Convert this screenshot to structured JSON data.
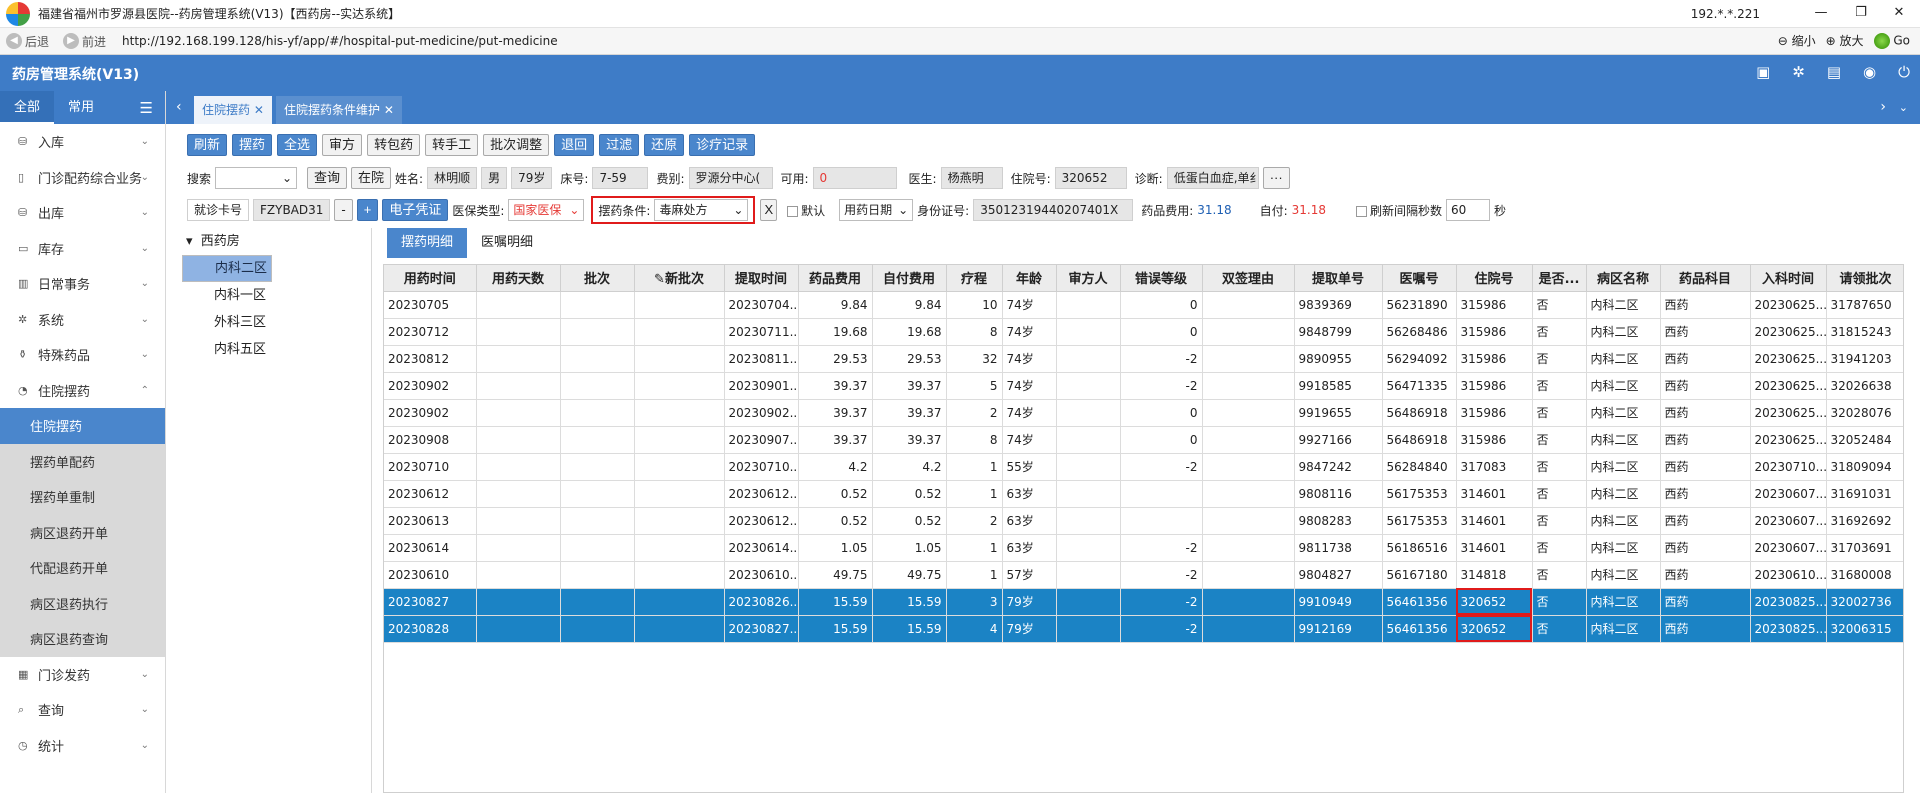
{
  "window": {
    "title": "福建省福州市罗源县医院--药房管理系统(V13)【西药房--实达系统】",
    "ip": "192.*.*.221",
    "minimize": "—",
    "restore": "❐",
    "close": "✕"
  },
  "browser": {
    "back": "后退",
    "forward": "前进",
    "url": "http://192.168.199.128/his-yf/app/#/hospital-put-medicine/put-medicine",
    "zoom_out": "缩小",
    "zoom_in": "放大",
    "go": "Go"
  },
  "app": {
    "title": "药房管理系统(V13)"
  },
  "sidebar": {
    "tabs": [
      "全部",
      "常用"
    ],
    "items": [
      {
        "label": "入库"
      },
      {
        "label": "门诊配药综合业务"
      },
      {
        "label": "出库"
      },
      {
        "label": "库存"
      },
      {
        "label": "日常事务"
      },
      {
        "label": "系统"
      },
      {
        "label": "特殊药品"
      },
      {
        "label": "住院摆药"
      }
    ],
    "subitems": [
      "住院摆药",
      "摆药单配药",
      "摆药单重制",
      "病区退药开单",
      "代配退药开单",
      "病区退药执行",
      "病区退药查询"
    ],
    "items_after": [
      {
        "label": "门诊发药"
      },
      {
        "label": "查询"
      },
      {
        "label": "统计"
      }
    ]
  },
  "tabs": [
    {
      "label": "住院摆药"
    },
    {
      "label": "住院摆药条件维护"
    }
  ],
  "toolbar": [
    "刷新",
    "摆药",
    "全选",
    "审方",
    "转包药",
    "转手工",
    "批次调整",
    "退回",
    "过滤",
    "还原",
    "诊疗记录"
  ],
  "patient": {
    "search_label": "搜索",
    "query_btn": "查询",
    "inhosp_btn": "在院",
    "name_label": "姓名:",
    "name": "林明顺",
    "sex": "男",
    "age": "79岁",
    "bed_label": "床号:",
    "bed": "7-59",
    "fee_label": "费别:",
    "fee": "罗源分中心(",
    "avail_label": "可用:",
    "avail": "0",
    "doctor_label": "医生:",
    "doctor": "杨燕明",
    "inpatient_label": "住院号:",
    "inpatient_no": "320652",
    "diag_label": "诊断:",
    "diag": "低蛋白血症,单纟",
    "more": "···"
  },
  "row3": {
    "card_label": "就诊卡号",
    "card_no": "FZYBAD31",
    "minus": "-",
    "plus": "+",
    "evoucher": "电子凭证",
    "ins_label": "医保类型:",
    "ins_value": "国家医保",
    "cond_label": "摆药条件:",
    "cond_value": "毒麻处方",
    "x": "X",
    "default_label": "默认",
    "date_type": "用药日期",
    "id_label": "身份证号:",
    "id_no": "35012319440207401X",
    "drug_fee_label": "药品费用:",
    "drug_fee": "31.18",
    "self_pay_label": "自付:",
    "self_pay": "31.18",
    "refresh_label": "刷新间隔秒数",
    "refresh_sec": "60",
    "sec": "秒"
  },
  "tree": {
    "root": "西药房",
    "children": [
      "内科二区",
      "内科一区",
      "外科三区",
      "内科五区"
    ],
    "selected_index": 0
  },
  "detail_tabs": [
    "摆药明细",
    "医嘱明细"
  ],
  "table": {
    "headers": [
      "用药时间",
      "用药天数",
      "批次",
      "✎新批次",
      "提取时间",
      "药品费用",
      "自付费用",
      "疗程",
      "年龄",
      "审方人",
      "错误等级",
      "双签理由",
      "提取单号",
      "医嘱号",
      "住院号",
      "是否...",
      "病区名称",
      "药品科目",
      "入科时间",
      "请领批次"
    ],
    "rows": [
      [
        "20230705",
        "",
        "",
        "",
        "20230704...",
        "9.84",
        "9.84",
        "10",
        "74岁",
        "",
        "0",
        "",
        "9839369",
        "56231890",
        "315986",
        "否",
        "内科二区",
        "西药",
        "20230625...",
        "31787650"
      ],
      [
        "20230712",
        "",
        "",
        "",
        "20230711...",
        "19.68",
        "19.68",
        "8",
        "74岁",
        "",
        "0",
        "",
        "9848799",
        "56268486",
        "315986",
        "否",
        "内科二区",
        "西药",
        "20230625...",
        "31815243"
      ],
      [
        "20230812",
        "",
        "",
        "",
        "20230811...",
        "29.53",
        "29.53",
        "32",
        "74岁",
        "",
        "-2",
        "",
        "9890955",
        "56294092",
        "315986",
        "否",
        "内科二区",
        "西药",
        "20230625...",
        "31941203"
      ],
      [
        "20230902",
        "",
        "",
        "",
        "20230901...",
        "39.37",
        "39.37",
        "5",
        "74岁",
        "",
        "-2",
        "",
        "9918585",
        "56471335",
        "315986",
        "否",
        "内科二区",
        "西药",
        "20230625...",
        "32026638"
      ],
      [
        "20230902",
        "",
        "",
        "",
        "20230902...",
        "39.37",
        "39.37",
        "2",
        "74岁",
        "",
        "0",
        "",
        "9919655",
        "56486918",
        "315986",
        "否",
        "内科二区",
        "西药",
        "20230625...",
        "32028076"
      ],
      [
        "20230908",
        "",
        "",
        "",
        "20230907...",
        "39.37",
        "39.37",
        "8",
        "74岁",
        "",
        "0",
        "",
        "9927166",
        "56486918",
        "315986",
        "否",
        "内科二区",
        "西药",
        "20230625...",
        "32052484"
      ],
      [
        "20230710",
        "",
        "",
        "",
        "20230710...",
        "4.2",
        "4.2",
        "1",
        "55岁",
        "",
        "-2",
        "",
        "9847242",
        "56284840",
        "317083",
        "否",
        "内科二区",
        "西药",
        "20230710...",
        "31809094"
      ],
      [
        "20230612",
        "",
        "",
        "",
        "20230612...",
        "0.52",
        "0.52",
        "1",
        "63岁",
        "",
        "",
        "",
        "9808116",
        "56175353",
        "314601",
        "否",
        "内科二区",
        "西药",
        "20230607...",
        "31691031"
      ],
      [
        "20230613",
        "",
        "",
        "",
        "20230612...",
        "0.52",
        "0.52",
        "2",
        "63岁",
        "",
        "",
        "",
        "9808283",
        "56175353",
        "314601",
        "否",
        "内科二区",
        "西药",
        "20230607...",
        "31692692"
      ],
      [
        "20230614",
        "",
        "",
        "",
        "20230614...",
        "1.05",
        "1.05",
        "1",
        "63岁",
        "",
        "-2",
        "",
        "9811738",
        "56186516",
        "314601",
        "否",
        "内科二区",
        "西药",
        "20230607...",
        "31703691"
      ],
      [
        "20230610",
        "",
        "",
        "",
        "20230610...",
        "49.75",
        "49.75",
        "1",
        "57岁",
        "",
        "-2",
        "",
        "9804827",
        "56167180",
        "314818",
        "否",
        "内科二区",
        "西药",
        "20230610...",
        "31680008"
      ],
      [
        "20230827",
        "",
        "",
        "",
        "20230826...",
        "15.59",
        "15.59",
        "3",
        "79岁",
        "",
        "-2",
        "",
        "9910949",
        "56461356",
        "320652",
        "否",
        "内科二区",
        "西药",
        "20230825...",
        "32002736"
      ],
      [
        "20230828",
        "",
        "",
        "",
        "20230827...",
        "15.59",
        "15.59",
        "4",
        "79岁",
        "",
        "-2",
        "",
        "9912169",
        "56461356",
        "320652",
        "否",
        "内科二区",
        "西药",
        "20230825...",
        "32006315"
      ]
    ]
  }
}
